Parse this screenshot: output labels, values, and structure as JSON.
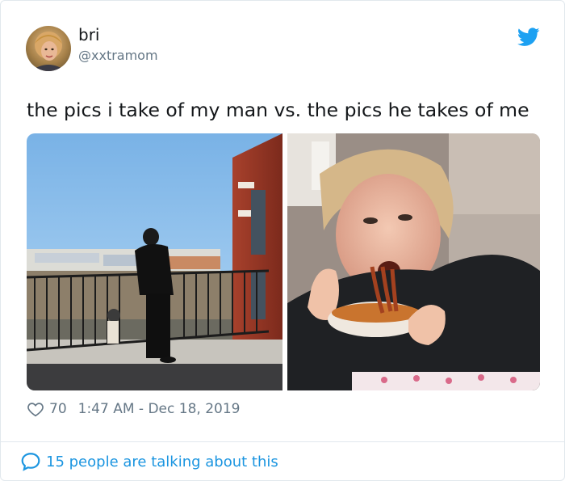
{
  "user": {
    "display_name": "bri",
    "handle": "@xxtramom"
  },
  "tweet": {
    "text": "the pics i take of my man vs. the pics he takes of me"
  },
  "stats": {
    "likes": "70",
    "timestamp": "1:47 AM - Dec 18, 2019"
  },
  "footer": {
    "talking": "15 people are talking about this"
  },
  "icons": {
    "bird": "twitter-bird-icon",
    "heart": "heart-outline-icon",
    "bubble": "speech-bubble-icon"
  },
  "colors": {
    "brand_blue": "#1da1f2",
    "link_blue": "#1b95e0",
    "muted": "#657786",
    "border": "#e1e8ed"
  }
}
